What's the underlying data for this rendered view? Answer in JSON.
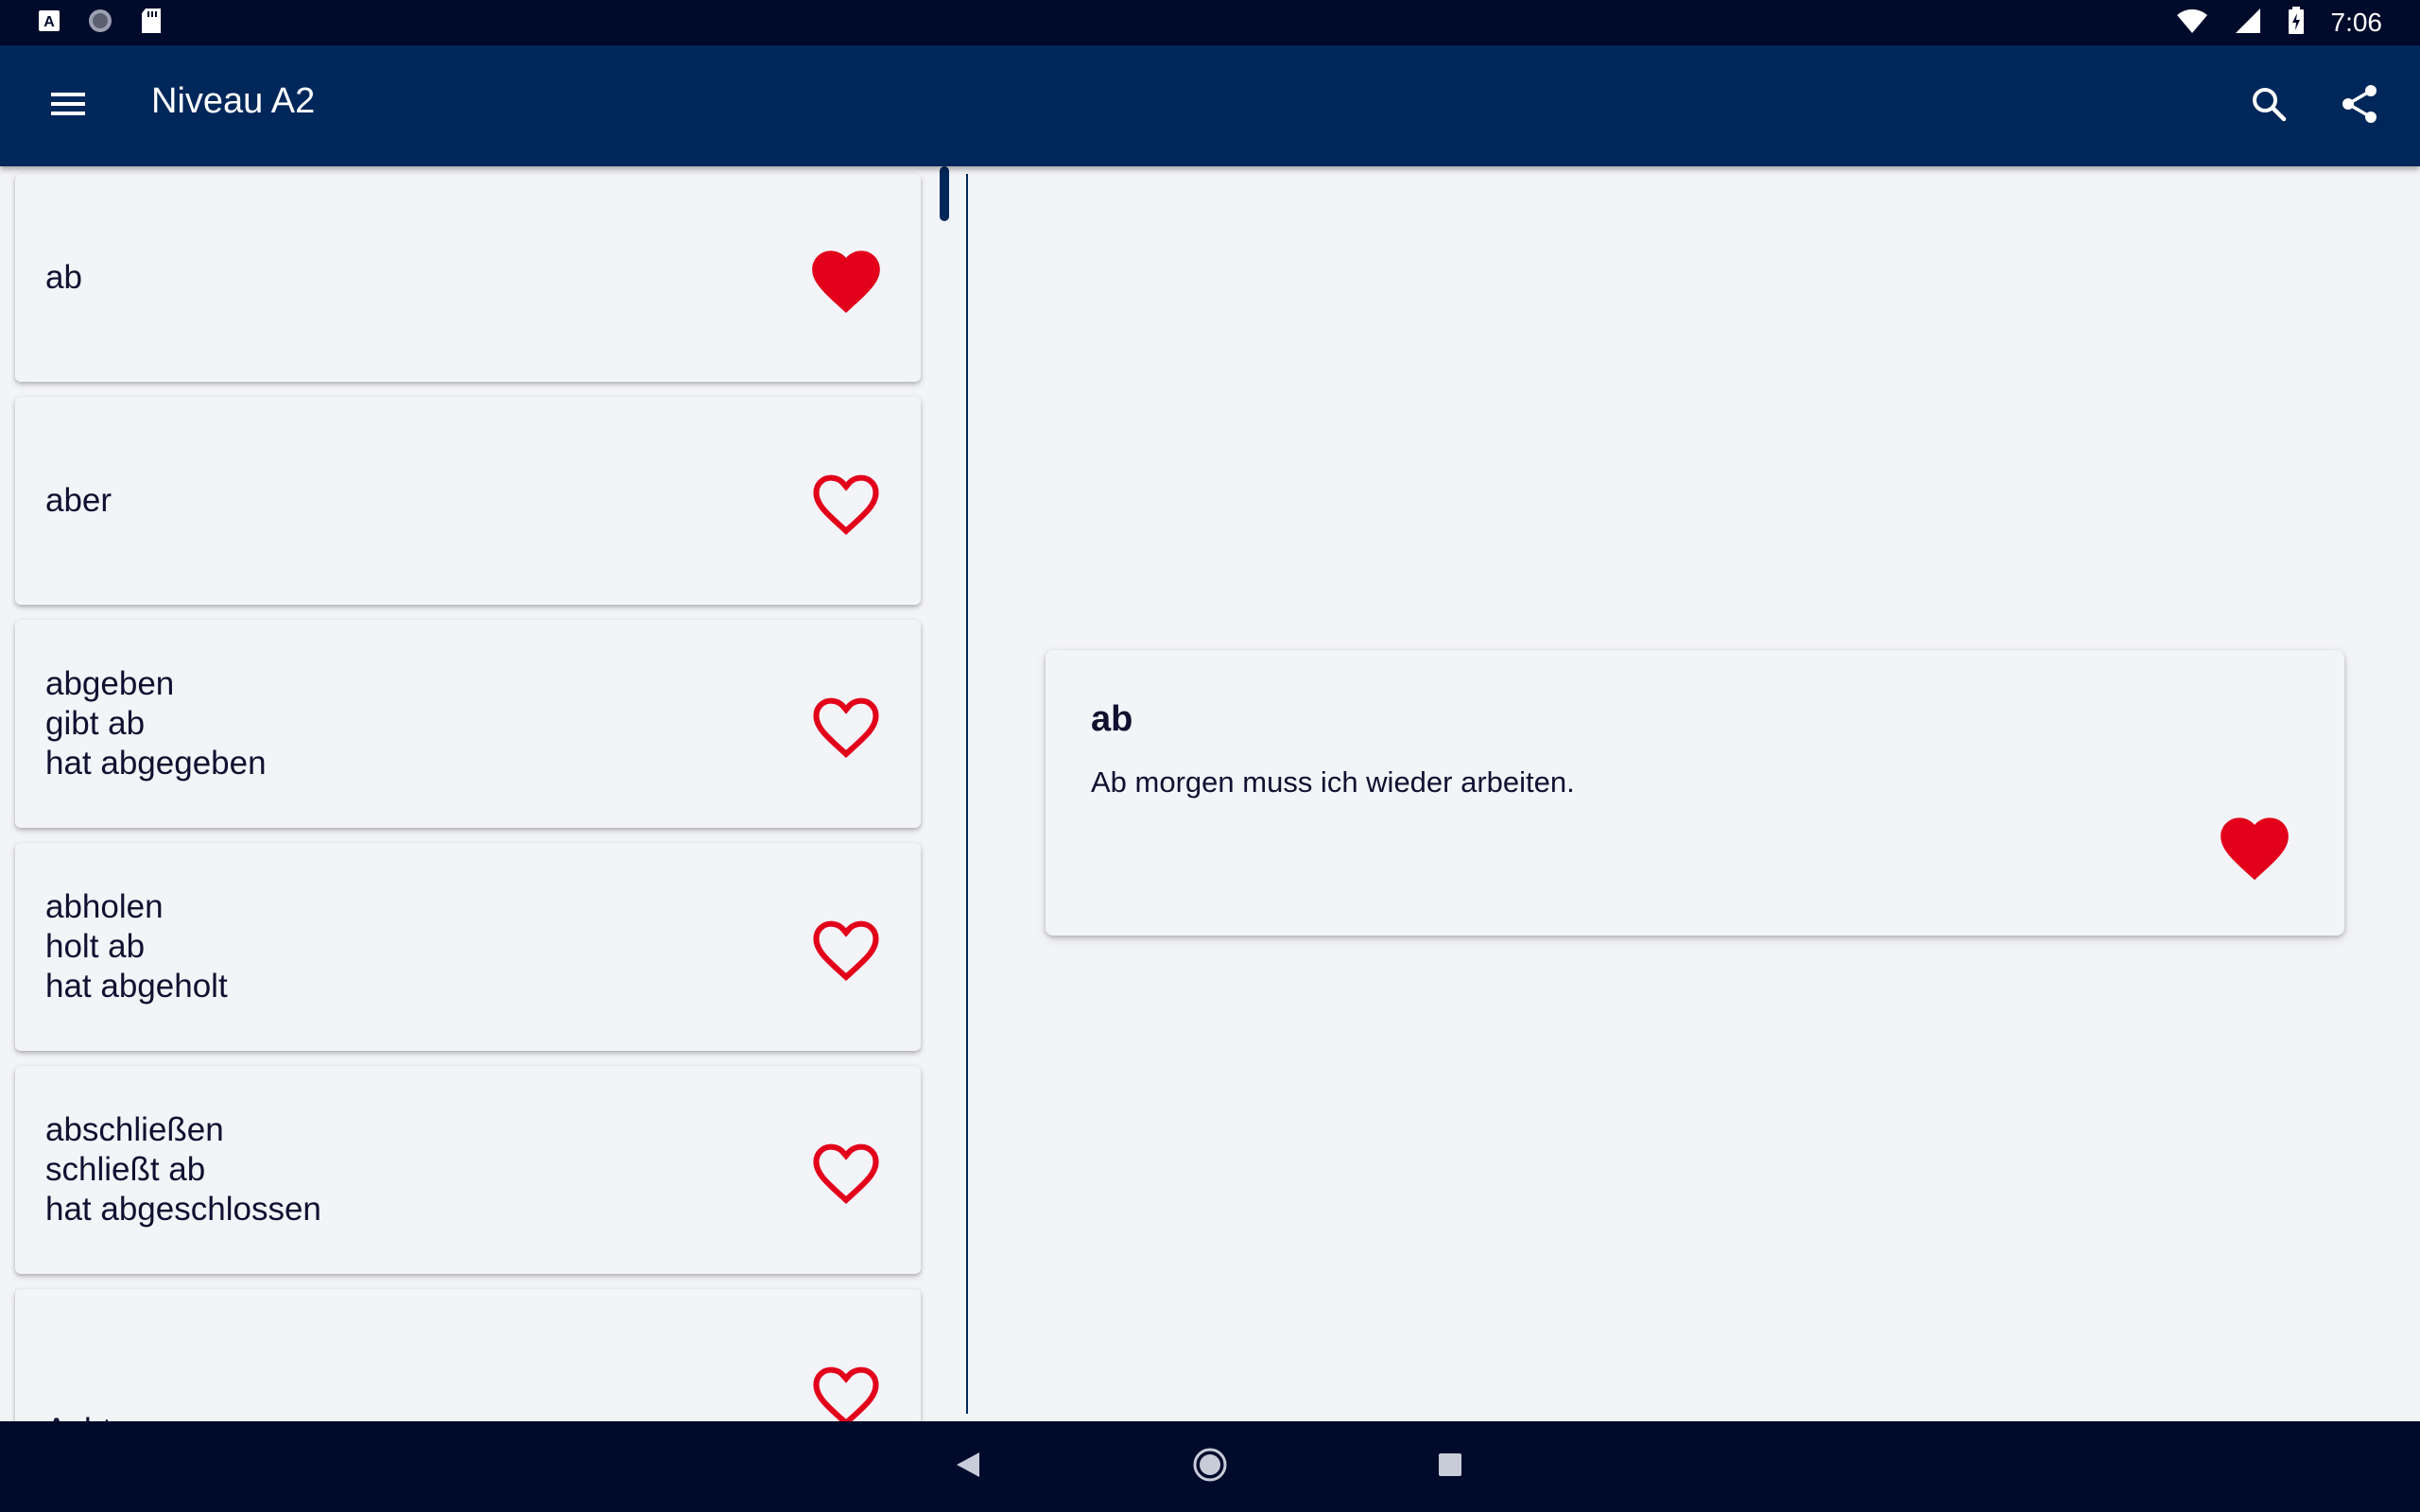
{
  "status_bar": {
    "time": "7:06",
    "left_icons": [
      "a-keyboard-icon",
      "circle-app-icon",
      "sd-card-icon"
    ],
    "right_icons": [
      "wifi-icon",
      "cell-signal-icon",
      "battery-charging-icon"
    ]
  },
  "app_bar": {
    "title": "Niveau A2",
    "menu_icon": "hamburger-menu-icon",
    "search_icon": "search-icon",
    "share_icon": "share-icon"
  },
  "words": [
    {
      "lines": [
        "ab"
      ],
      "favorite": true
    },
    {
      "lines": [
        "aber"
      ],
      "favorite": false
    },
    {
      "lines": [
        "abgeben",
        "gibt ab",
        "hat abgegeben"
      ],
      "favorite": false
    },
    {
      "lines": [
        "abholen",
        "holt ab",
        "hat abgeholt"
      ],
      "favorite": false
    },
    {
      "lines": [
        "abschließen",
        "schließt ab",
        "hat abgeschlossen"
      ],
      "favorite": false
    },
    {
      "lines": [
        "Achtung"
      ],
      "favorite": false
    }
  ],
  "detail": {
    "word": "ab",
    "sentence": "Ab morgen muss ich wieder arbeiten.",
    "favorite": true
  },
  "colors": {
    "app_bar": "#00275a",
    "status_bar": "#000a2b",
    "heart": "#e2001a",
    "background": "#f3f4f8"
  },
  "nav_bar": {
    "icons": [
      "back-icon",
      "home-icon",
      "recents-icon"
    ]
  }
}
